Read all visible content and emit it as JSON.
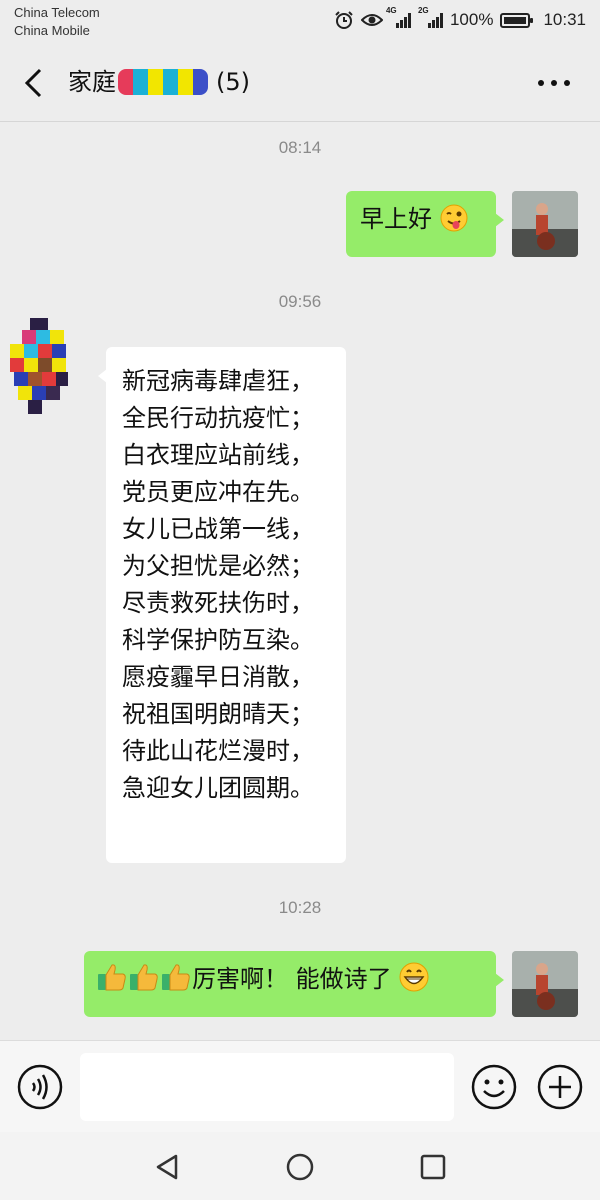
{
  "status_bar": {
    "carrier_1": "China Telecom",
    "carrier_2": "China Mobile",
    "network_1": "4G",
    "network_2": "2G",
    "battery": "100%",
    "time": "10:31"
  },
  "header": {
    "title_prefix": "家庭",
    "member_count": "(5)"
  },
  "messages": [
    {
      "timestamp": "08:14",
      "side": "right",
      "text": "早上好",
      "emoji": "winking-tongue-emoji"
    },
    {
      "timestamp": "09:56",
      "side": "left",
      "lines": [
        "新冠病毒肆虐狂，",
        "全民行动抗疫忙；",
        "白衣理应站前线，",
        "党员更应冲在先。",
        "女儿已战第一线，",
        "为父担忧是必然；",
        "尽责救死扶伤时，",
        "科学保护防互染。",
        "愿疫霾早日消散，",
        "祝祖国明朗晴天；",
        "待此山花烂漫时，",
        "急迎女儿团圆期。"
      ]
    },
    {
      "timestamp": "10:28",
      "side": "right",
      "text": "厉害啊！ 能做诗了",
      "emoji": "grinning-emoji",
      "prefix_emoji": "thumbs-up-emoji"
    }
  ],
  "input": {
    "value": "",
    "placeholder": ""
  },
  "colors": {
    "background": "#ededed",
    "sent_bubble": "#95ec69",
    "received_bubble": "#ffffff",
    "timestamp_text": "#8a8a8a"
  },
  "icons": [
    "back-icon",
    "more-icon",
    "voice-icon",
    "emoji-icon",
    "plus-icon",
    "nav-back-icon",
    "nav-home-icon",
    "nav-recents-icon"
  ]
}
